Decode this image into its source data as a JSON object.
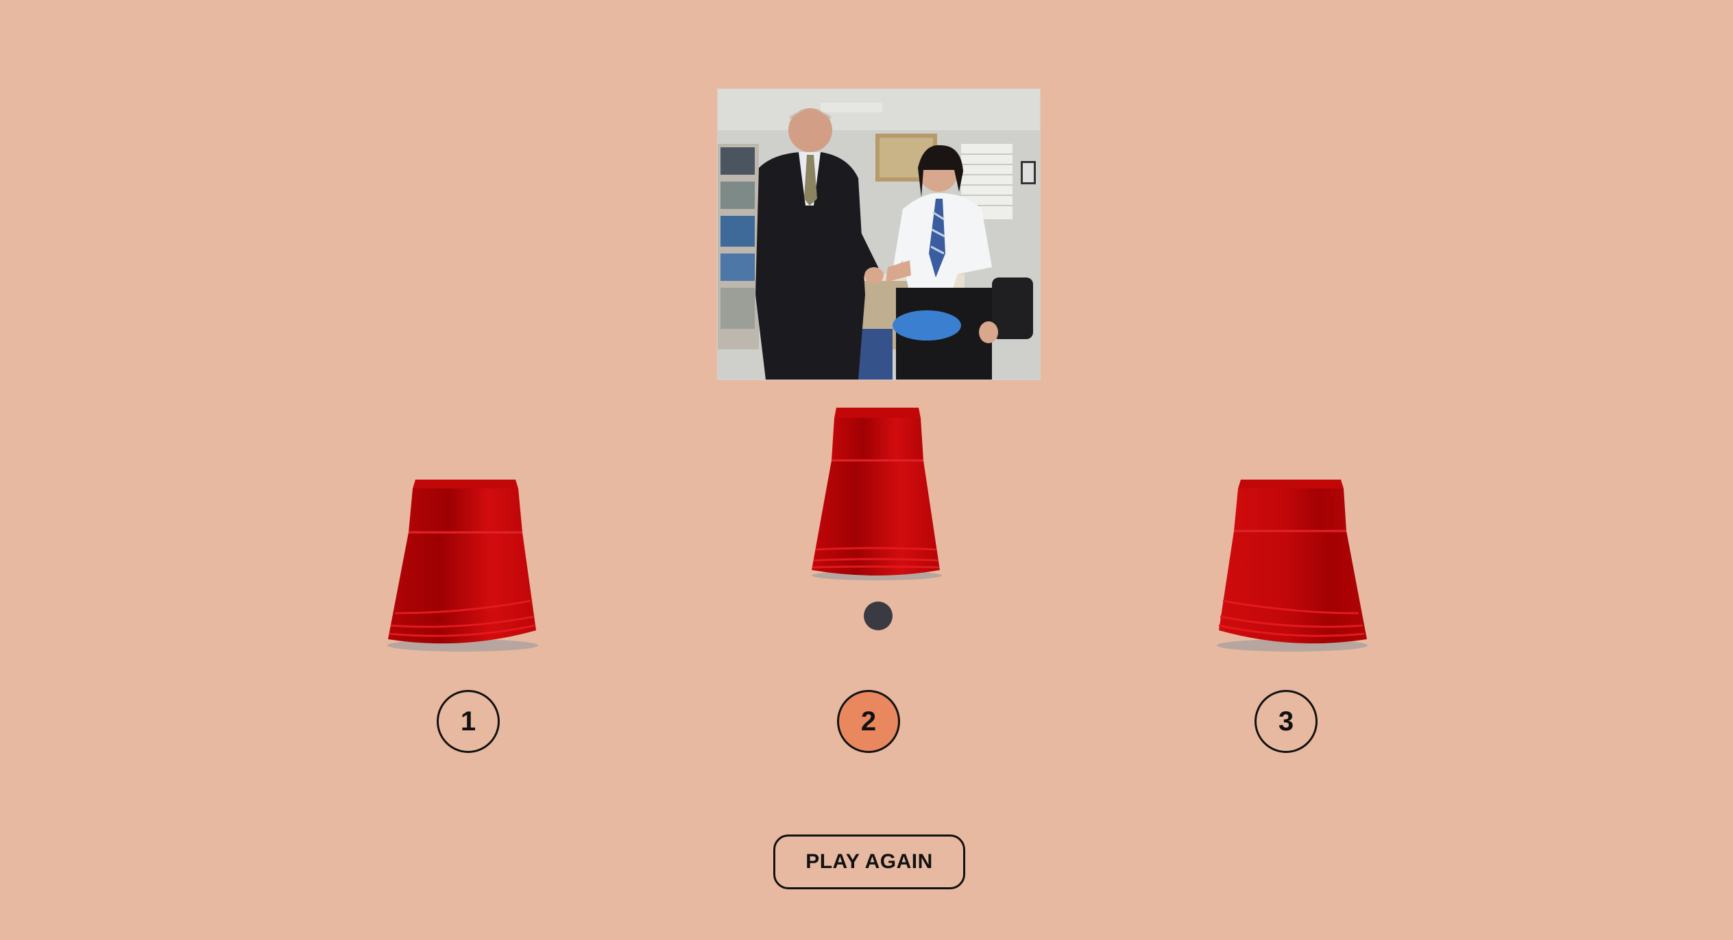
{
  "game": {
    "photo_icon": "handshake-office-photo",
    "cup_color": "#c8090a",
    "ball_color": "#393a42",
    "background": "#e8b9a1",
    "selected_color": "#e9875f",
    "cups": [
      {
        "id": "cup-1",
        "lifted": false
      },
      {
        "id": "cup-2",
        "lifted": true
      },
      {
        "id": "cup-3",
        "lifted": false
      }
    ],
    "choices": [
      {
        "label": "1",
        "selected": false
      },
      {
        "label": "2",
        "selected": true
      },
      {
        "label": "3",
        "selected": false
      }
    ],
    "play_again_label": "PLAY AGAIN"
  }
}
